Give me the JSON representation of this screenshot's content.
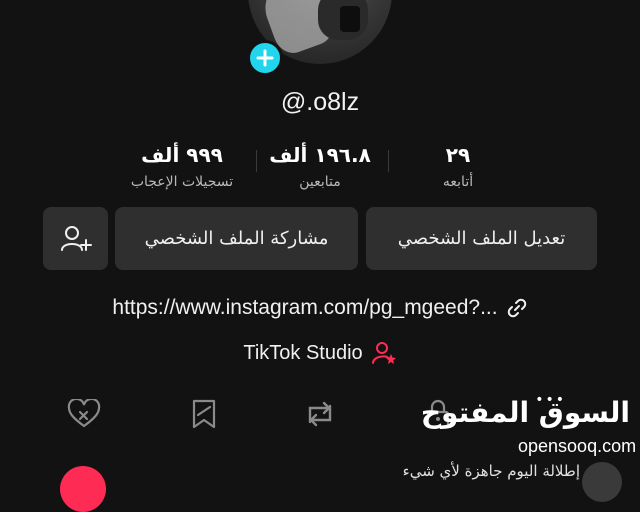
{
  "profile": {
    "username": "@.o8lz"
  },
  "stats": {
    "likes_value": "٩٩٩ ألف",
    "likes_label": "تسجيلات الإعجاب",
    "followers_value": "١٩٦.٨ ألف",
    "followers_label": "متابعين",
    "following_value": "٢٩",
    "following_label": "أتابعه"
  },
  "buttons": {
    "edit_profile": "تعديل الملف الشخصي",
    "share_profile": "مشاركة الملف الشخصي"
  },
  "bio": {
    "link": "https://www.instagram.com/pg_mgeed?...",
    "studio": "TikTok Studio"
  },
  "bottom": {
    "partial_text": "إطلالة اليوم جاهزة لأي شيء"
  },
  "watermark": {
    "brand": "السوق المفتوح",
    "domain": "opensooq.com"
  },
  "colors": {
    "accent_cyan": "#20d5ec",
    "accent_red": "#fe2c55",
    "background": "#121212",
    "button": "#2f2f2f"
  },
  "icons": [
    "plus-icon",
    "add-friend-icon",
    "link-icon",
    "studio-user-star-icon",
    "liked-videos-icon",
    "favorites-icon",
    "repost-icon",
    "lock-icon"
  ]
}
